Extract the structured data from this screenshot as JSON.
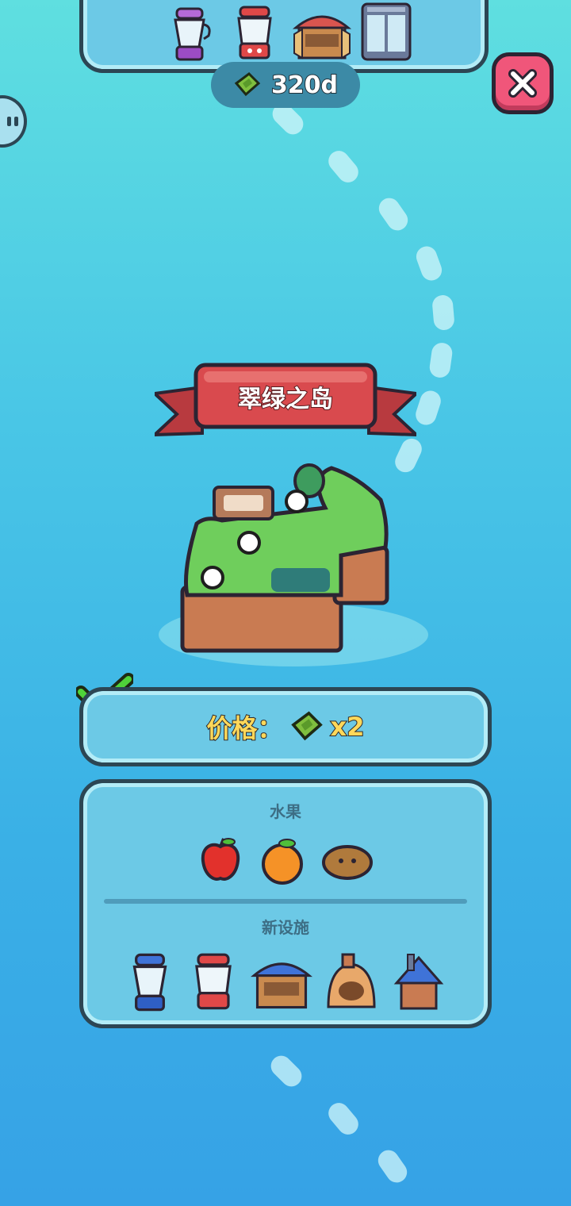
{
  "currency": {
    "icon": "cash-icon",
    "amount": "320d"
  },
  "top_facilities": [
    "purple-blender-icon",
    "red-juicer-icon",
    "market-stall-icon",
    "fridge-icon"
  ],
  "island": {
    "name": "翠绿之岛",
    "status": "unlocked"
  },
  "price": {
    "label": "价格：",
    "icon": "cash-icon",
    "multiplier": "x2"
  },
  "rewards": {
    "fruits_title": "水果",
    "fruits": [
      "apple-icon",
      "orange-icon",
      "potato-icon"
    ],
    "facilities_title": "新设施",
    "facilities": [
      "blue-blender-icon",
      "red-juicer-icon",
      "blue-market-stall-icon",
      "bakery-oven-icon",
      "blue-house-icon"
    ]
  },
  "colors": {
    "accent_pink": "#f0567a",
    "ribbon_red": "#d94a4e",
    "price_yellow": "#ffd85a",
    "panel_blue": "#6cc9e6"
  }
}
